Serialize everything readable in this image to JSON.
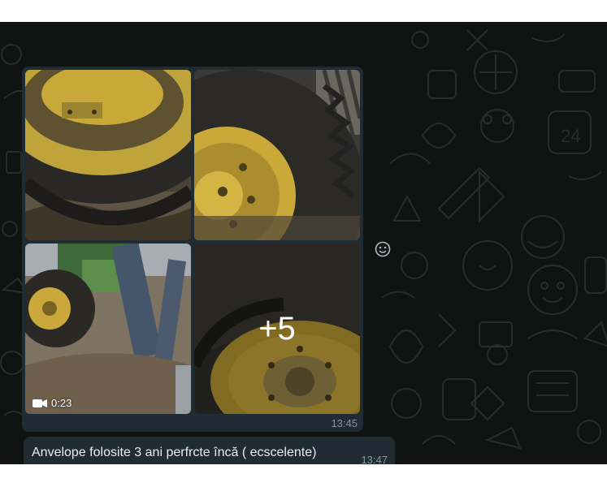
{
  "chat": {
    "media_message": {
      "more_count": "+5",
      "video_duration": "0:23",
      "time": "13:45"
    },
    "text_message": {
      "text": "Anvelope folosite 3 ani perfrcte încă ( ecscelente)",
      "time": "13:47"
    },
    "doodle_label": "24"
  },
  "icons": {
    "video": "video-camera-icon",
    "reaction": "smiley-face-icon"
  },
  "colors": {
    "chat_background": "#111312",
    "bubble": "#202c33",
    "message_text": "#e9edef",
    "meta_text": "#8696a0",
    "rim_yellow": "#c9a83a"
  }
}
